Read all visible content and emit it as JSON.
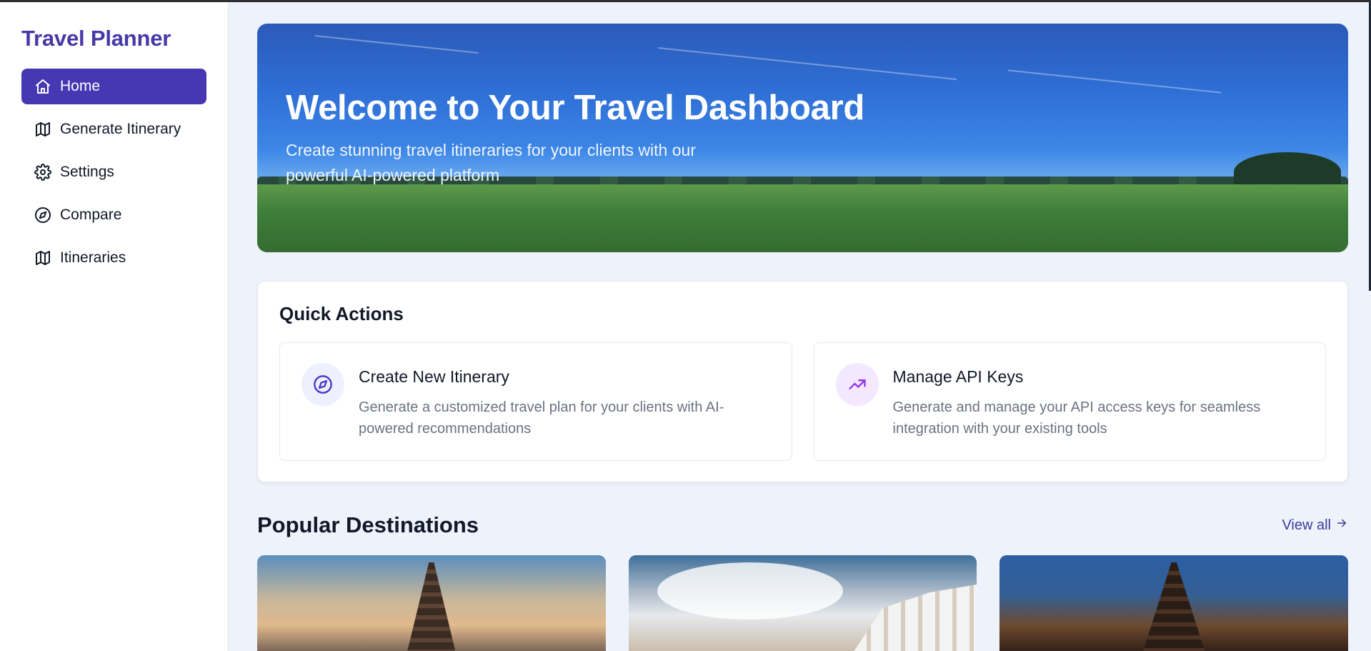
{
  "sidebar": {
    "brand": "Travel Planner",
    "items": [
      {
        "label": "Home",
        "icon": "home-icon",
        "active": true
      },
      {
        "label": "Generate Itinerary",
        "icon": "map-icon",
        "active": false
      },
      {
        "label": "Settings",
        "icon": "gear-icon",
        "active": false
      },
      {
        "label": "Compare",
        "icon": "compass-icon",
        "active": false
      },
      {
        "label": "Itineraries",
        "icon": "map-icon",
        "active": false
      }
    ]
  },
  "hero": {
    "title": "Welcome to Your Travel Dashboard",
    "subtitle": "Create stunning travel itineraries for your clients with our powerful AI-powered platform"
  },
  "quick_actions": {
    "title": "Quick Actions",
    "items": [
      {
        "title": "Create New Itinerary",
        "description": "Generate a customized travel plan for your clients with AI-powered recommendations",
        "icon": "compass-icon",
        "icon_color": "#4338ca",
        "icon_bg": "#eef0ff"
      },
      {
        "title": "Manage API Keys",
        "description": "Generate and manage your API access keys for seamless integration with your existing tools",
        "icon": "trending-up-icon",
        "icon_color": "#9333ea",
        "icon_bg": "#f4e8ff"
      }
    ]
  },
  "popular_destinations": {
    "title": "Popular Destinations",
    "view_all": "View all",
    "view_all_icon": "arrow-right-icon",
    "cards": [
      {
        "image": "temple-pagoda-image"
      },
      {
        "image": "white-village-seaside-image"
      },
      {
        "image": "pagoda-street-image"
      }
    ]
  },
  "colors": {
    "brand": "#4638a7",
    "active_nav": "#4638b2",
    "background": "#eef2fb"
  }
}
